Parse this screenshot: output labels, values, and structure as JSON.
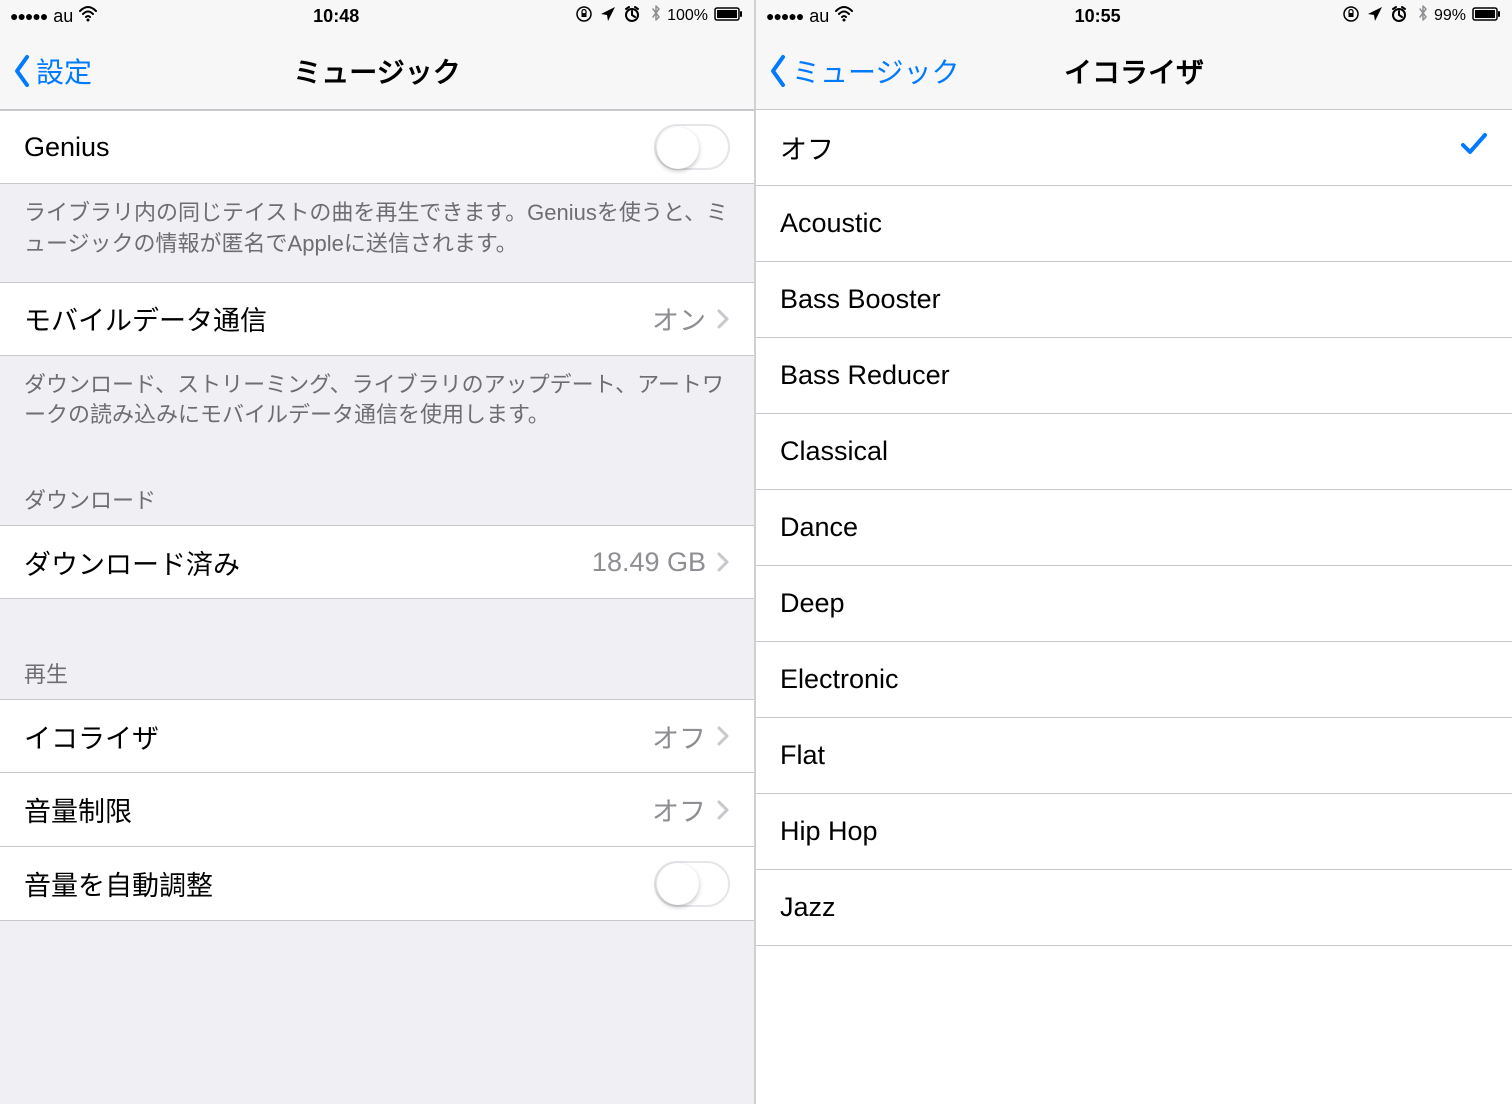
{
  "left": {
    "status": {
      "carrier": "au",
      "time": "10:48",
      "battery": "100%"
    },
    "nav": {
      "back": "設定",
      "title": "ミュージック"
    },
    "rows": {
      "genius": {
        "label": "Genius"
      },
      "genius_footer": "ライブラリ内の同じテイストの曲を再生できます。Geniusを使うと、ミュージックの情報が匿名でAppleに送信されます。",
      "mobile": {
        "label": "モバイルデータ通信",
        "value": "オン"
      },
      "mobile_footer": "ダウンロード、ストリーミング、ライブラリのアップデート、アートワークの読み込みにモバイルデータ通信を使用します。",
      "download_header": "ダウンロード",
      "downloaded": {
        "label": "ダウンロード済み",
        "value": "18.49 GB"
      },
      "playback_header": "再生",
      "eq": {
        "label": "イコライザ",
        "value": "オフ"
      },
      "volume_limit": {
        "label": "音量制限",
        "value": "オフ"
      },
      "sound_check": {
        "label": "音量を自動調整"
      }
    }
  },
  "right": {
    "status": {
      "carrier": "au",
      "time": "10:55",
      "battery": "99%"
    },
    "nav": {
      "back": "ミュージック",
      "title": "イコライザ"
    },
    "options": [
      {
        "label": "オフ",
        "selected": true
      },
      {
        "label": "Acoustic",
        "selected": false
      },
      {
        "label": "Bass Booster",
        "selected": false
      },
      {
        "label": "Bass Reducer",
        "selected": false
      },
      {
        "label": "Classical",
        "selected": false
      },
      {
        "label": "Dance",
        "selected": false
      },
      {
        "label": "Deep",
        "selected": false
      },
      {
        "label": "Electronic",
        "selected": false
      },
      {
        "label": "Flat",
        "selected": false
      },
      {
        "label": "Hip Hop",
        "selected": false
      },
      {
        "label": "Jazz",
        "selected": false
      }
    ]
  }
}
